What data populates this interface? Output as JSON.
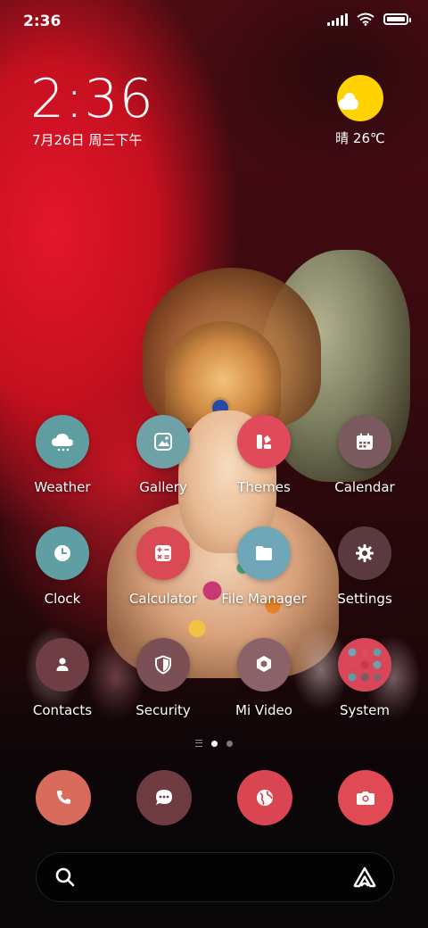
{
  "status_bar": {
    "time": "2:36"
  },
  "clock_widget": {
    "time": "2:36",
    "date": "7月26日 周三下午"
  },
  "weather_widget": {
    "condition_temp": "晴 26℃",
    "icon": "sun-cloud-icon"
  },
  "apps": [
    {
      "name": "Weather",
      "icon": "weather-cloud-icon",
      "color": "#5e9ea0"
    },
    {
      "name": "Gallery",
      "icon": "gallery-icon",
      "color": "#6fa2a6"
    },
    {
      "name": "Themes",
      "icon": "themes-icon",
      "color": "#e04a5a"
    },
    {
      "name": "Calendar",
      "icon": "calendar-icon",
      "color": "#7a5a5e"
    },
    {
      "name": "Clock",
      "icon": "clock-icon",
      "color": "#5f9ea3"
    },
    {
      "name": "Calculator",
      "icon": "calculator-icon",
      "color": "#d94a55"
    },
    {
      "name": "File Manager",
      "icon": "folder-icon",
      "color": "#6fa7b8"
    },
    {
      "name": "Settings",
      "icon": "gear-icon",
      "color": "#5a3a3e"
    },
    {
      "name": "Contacts",
      "icon": "contacts-icon",
      "color": "#6e3e44"
    },
    {
      "name": "Security",
      "icon": "shield-icon",
      "color": "#7a5055"
    },
    {
      "name": "Mi Video",
      "icon": "video-icon",
      "color": "#8a6268"
    },
    {
      "name": "System",
      "icon": "folder-grid-icon",
      "color": "#d9465a"
    }
  ],
  "dock": [
    {
      "name": "Phone",
      "icon": "phone-icon",
      "color": "#d96b5c"
    },
    {
      "name": "Messaging",
      "icon": "message-icon",
      "color": "#6e3c40"
    },
    {
      "name": "Browser",
      "icon": "globe-icon",
      "color": "#d94652"
    },
    {
      "name": "Camera",
      "icon": "camera-icon",
      "color": "#df4a55"
    }
  ],
  "page_indicator": {
    "pages": 2,
    "current": 1
  }
}
